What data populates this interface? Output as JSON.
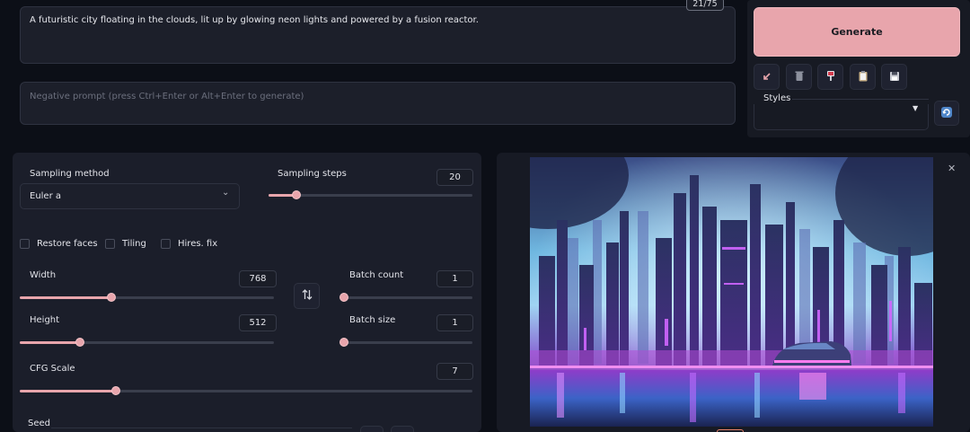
{
  "prompt": {
    "text": "A futuristic city floating in the clouds, lit up by glowing neon lights and powered by a fusion reactor.",
    "token_counter": "21/75",
    "negative_placeholder": "Negative prompt (press Ctrl+Enter or Alt+Enter to generate)"
  },
  "actions": {
    "generate_label": "Generate",
    "tool_icons": [
      "arrow-import-icon",
      "trash-icon",
      "paint-icon",
      "clipboard-icon",
      "save-icon"
    ],
    "styles_label": "Styles",
    "refresh_icon": "refresh-icon"
  },
  "settings": {
    "sampling_method": {
      "label": "Sampling method",
      "value": "Euler a"
    },
    "sampling_steps": {
      "label": "Sampling steps",
      "value": "20",
      "fraction": 0.13
    },
    "checkboxes": [
      {
        "label": "Restore faces",
        "checked": false
      },
      {
        "label": "Tiling",
        "checked": false
      },
      {
        "label": "Hires. fix",
        "checked": false
      }
    ],
    "width": {
      "label": "Width",
      "value": "768",
      "fraction": 0.36
    },
    "height": {
      "label": "Height",
      "value": "512",
      "fraction": 0.23
    },
    "batch_count": {
      "label": "Batch count",
      "value": "1",
      "fraction": 0.0
    },
    "batch_size": {
      "label": "Batch size",
      "value": "1",
      "fraction": 0.0
    },
    "cfg_scale": {
      "label": "CFG Scale",
      "value": "7",
      "fraction": 0.21
    },
    "seed": {
      "label": "Seed"
    },
    "swap_icon": "swap-dimensions-icon"
  },
  "output": {
    "close_icon": "close-icon",
    "image_description_icon": "generated-image"
  },
  "colors": {
    "accent": "#e8a5ac",
    "panel": "#1b1e2a",
    "background": "#0c0f17"
  }
}
